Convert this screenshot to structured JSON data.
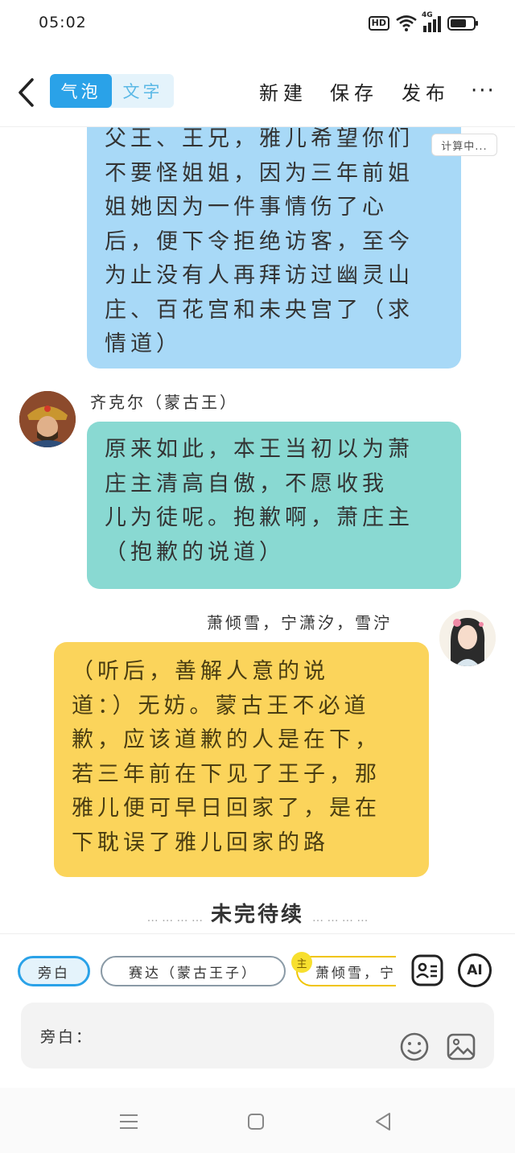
{
  "status": {
    "time": "05:02",
    "hd": "HD",
    "net": "4G"
  },
  "toolbar": {
    "mode_bubble": "气泡",
    "mode_text": "文字",
    "new": "新建",
    "save": "保存",
    "publish": "发布",
    "more": "···"
  },
  "chat": {
    "msg1": {
      "lines": [
        "父王、王兄，雅儿希望你们",
        "不要怪姐姐，因为三年前姐",
        "姐她因为一件事情伤了心",
        "后，便下令拒绝访客，至今",
        "为止没有人再拜访过幽灵山",
        "庄、百花宫和未央宫了（求",
        "情道）"
      ],
      "tag": "计算中..."
    },
    "msg2": {
      "name": "齐克尔（蒙古王）",
      "lines": [
        "原来如此，本王当初以为萧",
        "庄主清高自傲，不愿收我",
        "儿为徒呢。抱歉啊，萧庄主",
        "（抱歉的说道）"
      ]
    },
    "msg3": {
      "name": "萧倾雪，宁潇汐，雪泞",
      "lines": [
        "（听后，善解人意的说",
        "道：）无妨。蒙古王不必道",
        "歉，应该道歉的人是在下，",
        "若三年前在下见了王子，那",
        "雅儿便可早日回家了，是在",
        "下耽误了雅儿回家的路"
      ]
    },
    "to_be_continued": "未完待续",
    "dots": "… … … …"
  },
  "roles": {
    "narration": "旁白",
    "role2": "赛达（蒙古王子）",
    "role3_badge": "主",
    "role3": "萧倾雪，宁"
  },
  "input": {
    "placeholder": "旁白："
  },
  "icons": {
    "ai_label": "AI"
  },
  "colors": {
    "accent": "#2aa2e8",
    "bubble_blue": "#a8d9f7",
    "bubble_teal": "#89d9d2",
    "bubble_yellow": "#fbd45b"
  }
}
